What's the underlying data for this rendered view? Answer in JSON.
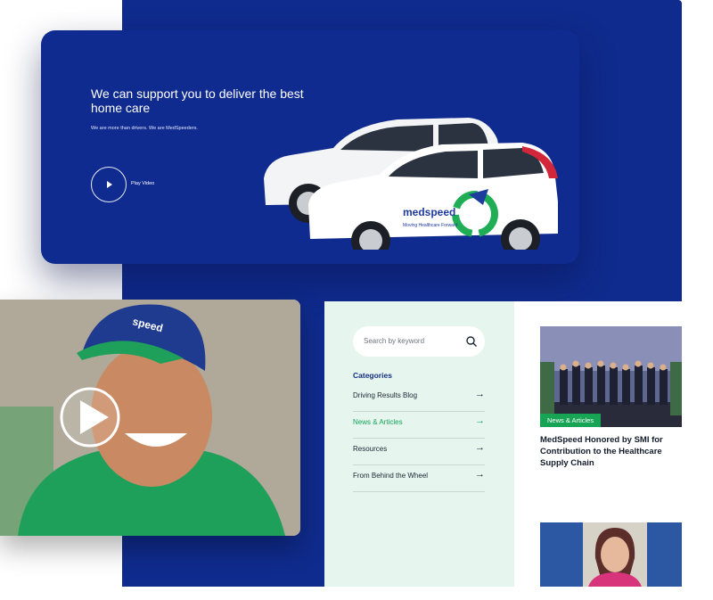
{
  "hero": {
    "title": "We can support you to deliver the best home care",
    "subtitle": "We are more than drivers. We are MedSpeeders.",
    "play_label": "Play Video"
  },
  "car": {
    "brand": "medspeed",
    "tagline": "Moving Healthcare Forward"
  },
  "photo": {
    "cap_text": "speed"
  },
  "sidebar": {
    "search_placeholder": "Search by keyword",
    "categories_title": "Categories",
    "items": [
      {
        "label": "Driving Results Blog",
        "active": false
      },
      {
        "label": "News & Articles",
        "active": true
      },
      {
        "label": "Resources",
        "active": false
      },
      {
        "label": "From Behind the Wheel",
        "active": false
      }
    ]
  },
  "news": [
    {
      "badge": "News & Articles",
      "title": "MedSpeed Honored by SMI for Contribution to the Healthcare Supply Chain"
    }
  ],
  "colors": {
    "navy": "#0f2b8d",
    "green": "#18a455",
    "mint": "#e6f5ee"
  }
}
